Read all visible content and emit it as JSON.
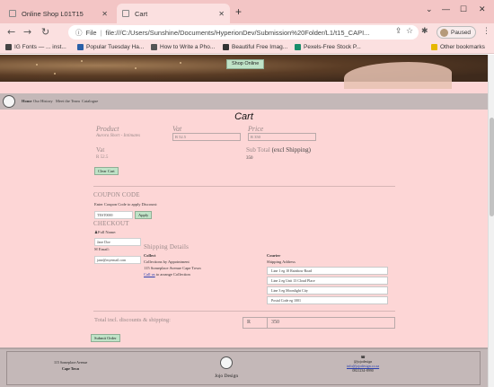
{
  "browser": {
    "tabs": [
      {
        "title": "Online Shop L01T15"
      },
      {
        "title": "Cart"
      }
    ],
    "address_label": "File",
    "url": "file:///C:/Users/Sunshine/Documents/HyperionDev/Submission%20Folder/L1/t15_CAPI...",
    "profile_status": "Paused",
    "bookmarks": [
      {
        "label": "IG Fonts — ... inst...",
        "color": "#444"
      },
      {
        "label": "Popular Tuesday Ha...",
        "color": "#2b5fa7"
      },
      {
        "label": "How to Write a Pho...",
        "color": "#555"
      },
      {
        "label": "Beautiful Free Imag...",
        "color": "#333"
      },
      {
        "label": "Pexels-Free Stock P...",
        "color": "#1a8d6a"
      }
    ],
    "other_bookmarks": "Other bookmarks"
  },
  "page": {
    "hero_button": "Shop Online",
    "nav": [
      "Home",
      "Our History",
      "Meet the Team",
      "Catalogue"
    ],
    "title": "Cart",
    "cart": {
      "product_label": "Product",
      "product_value": "Aurora Short - Intimates",
      "vat_label": "Vat",
      "vat_field": "R 52.5",
      "price_label": "Price",
      "price_field": "R 350",
      "vat_label2": "Vat",
      "vat_value": "R 52.5",
      "subtotal_label": "Sub Total",
      "subtotal_note": "(excl Shipping)",
      "subtotal_value": "350",
      "clear_button": "Clear Cart"
    },
    "coupon": {
      "heading": "COUPON CODE",
      "prompt": "Enter Coupon Code to apply Discount:",
      "input_value": "TEST0000",
      "apply_button": "Apply"
    },
    "checkout": {
      "heading": "CHECKOUT",
      "fullname_label": "Full Name:",
      "fullname_value": "Jane Doe",
      "email_label": "Email:",
      "email_value": "jane@myemail.com"
    },
    "shipping": {
      "heading": "Shipping Details",
      "collect_title": "Collect",
      "collect_line1": "Collections by Appointment",
      "collect_line2": "115 Someplace Avenue Cape Town",
      "collect_link": "Call us",
      "collect_line3": "to arrange Collection",
      "courier_title": "Courier",
      "courier_line1": "Shipping Address",
      "address_options": [
        "Line 1 eg 10 Rainbow Road",
        "Line 2 eg Unit 13 Cloud Place",
        "Line 3 eg Moonlight City",
        "Postal Code eg 1001"
      ]
    },
    "total": {
      "label": "Total incl. discounts & shipping:",
      "currency": "R",
      "value": "350",
      "submit_button": "Submit Order"
    },
    "footer": {
      "address_line1": "115 Someplace Avenue",
      "address_line2": "Cape Town",
      "brand": "Jojo Design",
      "contact_handle": "@jojodesign",
      "contact_email": "info@jojodesign.co.za",
      "contact_phone": "0821234-8990"
    }
  }
}
